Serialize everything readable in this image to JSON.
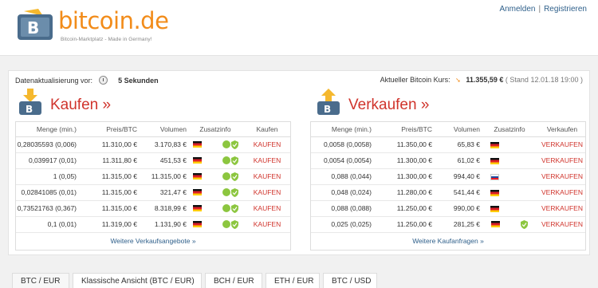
{
  "brand": {
    "name": "bitcoin.de",
    "tagline": "Bitcoin-Marktplatz - Made in Germany!",
    "color": "#f28c1a"
  },
  "top_links": {
    "login": "Anmelden",
    "register": "Registrieren"
  },
  "status": {
    "refresh_label": "Datenaktualisierung vor:",
    "refresh_value": "5 Sekunden",
    "rate_label": "Aktueller Bitcoin Kurs:",
    "rate_value": "11.355,59 €",
    "rate_stand": "( Stand 12.01.18 19:00 )"
  },
  "buy": {
    "title": "Kaufen »",
    "headers": [
      "Menge (min.)",
      "Preis/BTC",
      "Volumen",
      "Zusatzinfo",
      "Kaufen"
    ],
    "rows": [
      {
        "menge": "0,28035593 (0,006)",
        "preis": "11.310,00 €",
        "volumen": "3.170,83 €",
        "action": "KAUFEN"
      },
      {
        "menge": "0,039917 (0,01)",
        "preis": "11.311,80 €",
        "volumen": "451,53 €",
        "action": "KAUFEN"
      },
      {
        "menge": "1 (0,05)",
        "preis": "11.315,00 €",
        "volumen": "11.315,00 €",
        "action": "KAUFEN"
      },
      {
        "menge": "0,02841085 (0,01)",
        "preis": "11.315,00 €",
        "volumen": "321,47 €",
        "action": "KAUFEN"
      },
      {
        "menge": "0,73521763 (0,367)",
        "preis": "11.315,00 €",
        "volumen": "8.318,99 €",
        "action": "KAUFEN"
      },
      {
        "menge": "0,1 (0,01)",
        "preis": "11.319,00 €",
        "volumen": "1.131,90 €",
        "action": "KAUFEN"
      }
    ],
    "more": "Weitere Verkaufsangebote »"
  },
  "sell": {
    "title": "Verkaufen »",
    "headers": [
      "Menge (min.)",
      "Preis/BTC",
      "Volumen",
      "Zusatzinfo",
      "Verkaufen"
    ],
    "rows": [
      {
        "menge": "0,0058 (0,0058)",
        "preis": "11.350,00 €",
        "volumen": "65,83 €",
        "action": "VERKAUFEN"
      },
      {
        "menge": "0,0054 (0,0054)",
        "preis": "11.300,00 €",
        "volumen": "61,02 €",
        "action": "VERKAUFEN"
      },
      {
        "menge": "0,088 (0,044)",
        "preis": "11.300,00 €",
        "volumen": "994,40 €",
        "action": "VERKAUFEN"
      },
      {
        "menge": "0,048 (0,024)",
        "preis": "11.280,00 €",
        "volumen": "541,44 €",
        "action": "VERKAUFEN"
      },
      {
        "menge": "0,088 (0,088)",
        "preis": "11.250,00 €",
        "volumen": "990,00 €",
        "action": "VERKAUFEN"
      },
      {
        "menge": "0,025 (0,025)",
        "preis": "11.250,00 €",
        "volumen": "281,25 €",
        "action": "VERKAUFEN"
      }
    ],
    "more": "Weitere Kaufanfragen »"
  },
  "tabs": [
    "BTC / EUR",
    "Klassische Ansicht (BTC / EUR)",
    "BCH / EUR",
    "ETH / EUR",
    "BTC / USD"
  ],
  "colors": {
    "accent_red": "#d0342c",
    "link_blue": "#2e5f8a",
    "icon_yellow": "#f5b82e"
  }
}
